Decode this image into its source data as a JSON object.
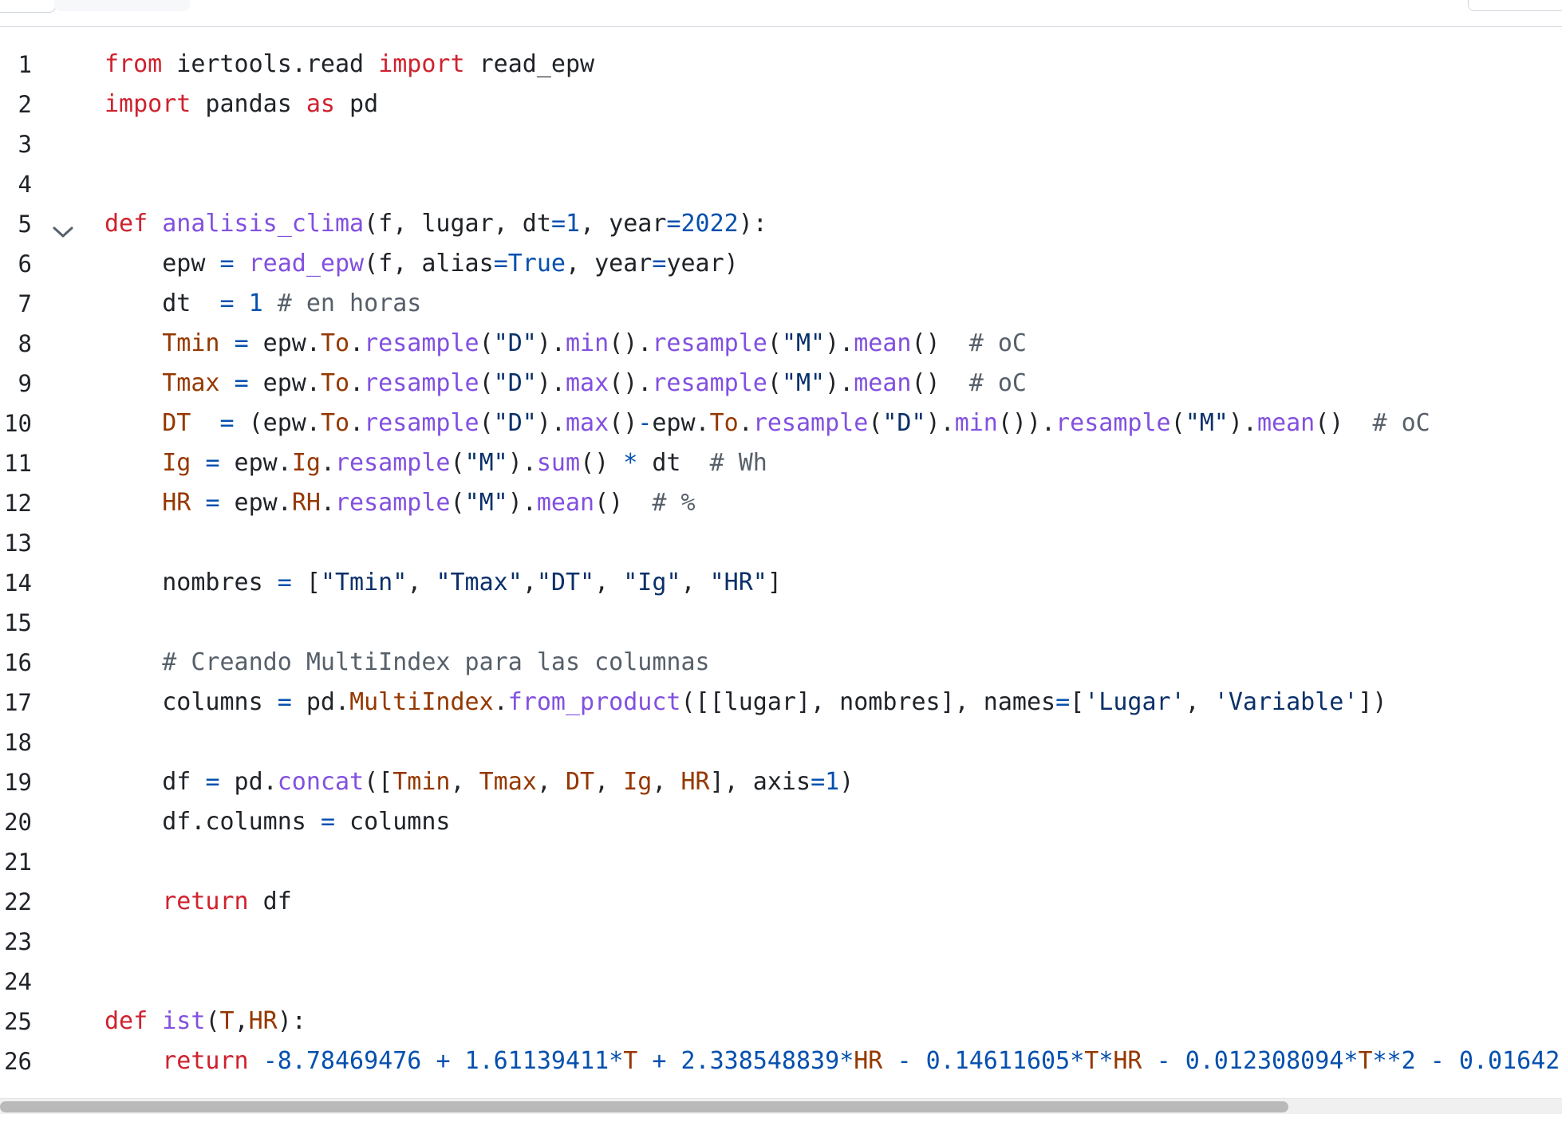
{
  "editor": {
    "lines": [
      {
        "n": "1",
        "html": "<span class=\"kw\">from</span> iertools.read <span class=\"kw\">import</span> read_epw"
      },
      {
        "n": "2",
        "html": "<span class=\"kw\">import</span> pandas <span class=\"kw\">as</span> pd"
      },
      {
        "n": "3",
        "html": ""
      },
      {
        "n": "4",
        "html": ""
      },
      {
        "n": "5",
        "html": "<span class=\"kw\">def</span> <span class=\"fn\">analisis_clima</span>(f, lugar, dt<span class=\"cn\">=</span><span class=\"cn\">1</span>, year<span class=\"cn\">=</span><span class=\"cn\">2022</span>):",
        "fold": true
      },
      {
        "n": "6",
        "html": "    epw <span class=\"cn\">=</span> <span class=\"fn\">read_epw</span>(f, alias<span class=\"cn\">=</span><span class=\"cn\">True</span>, year<span class=\"cn\">=</span>year)"
      },
      {
        "n": "7",
        "html": "    dt  <span class=\"cn\">=</span> <span class=\"cn\">1</span> <span class=\"cm\"># en horas</span>"
      },
      {
        "n": "8",
        "html": "    <span class=\"vr\">Tmin</span> <span class=\"cn\">=</span> epw.<span class=\"vr\">To</span>.<span class=\"fn\">resample</span>(<span class=\"str\">\"D\"</span>).<span class=\"fn\">min</span>().<span class=\"fn\">resample</span>(<span class=\"str\">\"M\"</span>).<span class=\"fn\">mean</span>()  <span class=\"cm\"># oC</span>"
      },
      {
        "n": "9",
        "html": "    <span class=\"vr\">Tmax</span> <span class=\"cn\">=</span> epw.<span class=\"vr\">To</span>.<span class=\"fn\">resample</span>(<span class=\"str\">\"D\"</span>).<span class=\"fn\">max</span>().<span class=\"fn\">resample</span>(<span class=\"str\">\"M\"</span>).<span class=\"fn\">mean</span>()  <span class=\"cm\"># oC</span>"
      },
      {
        "n": "10",
        "html": "    <span class=\"vr\">DT</span>  <span class=\"cn\">=</span> (epw.<span class=\"vr\">To</span>.<span class=\"fn\">resample</span>(<span class=\"str\">\"D\"</span>).<span class=\"fn\">max</span>()<span class=\"cn\">-</span>epw.<span class=\"vr\">To</span>.<span class=\"fn\">resample</span>(<span class=\"str\">\"D\"</span>).<span class=\"fn\">min</span>()).<span class=\"fn\">resample</span>(<span class=\"str\">\"M\"</span>).<span class=\"fn\">mean</span>()  <span class=\"cm\"># oC</span>"
      },
      {
        "n": "11",
        "html": "    <span class=\"vr\">Ig</span> <span class=\"cn\">=</span> epw.<span class=\"vr\">Ig</span>.<span class=\"fn\">resample</span>(<span class=\"str\">\"M\"</span>).<span class=\"fn\">sum</span>() <span class=\"cn\">*</span> dt  <span class=\"cm\"># Wh</span>"
      },
      {
        "n": "12",
        "html": "    <span class=\"vr\">HR</span> <span class=\"cn\">=</span> epw.<span class=\"vr\">RH</span>.<span class=\"fn\">resample</span>(<span class=\"str\">\"M\"</span>).<span class=\"fn\">mean</span>()  <span class=\"cm\"># %</span>"
      },
      {
        "n": "13",
        "html": ""
      },
      {
        "n": "14",
        "html": "    nombres <span class=\"cn\">=</span> [<span class=\"str\">\"Tmin\"</span>, <span class=\"str\">\"Tmax\"</span>,<span class=\"str\">\"DT\"</span>, <span class=\"str\">\"Ig\"</span>, <span class=\"str\">\"HR\"</span>]"
      },
      {
        "n": "15",
        "html": ""
      },
      {
        "n": "16",
        "html": "    <span class=\"cm\"># Creando MultiIndex para las columnas</span>"
      },
      {
        "n": "17",
        "html": "    columns <span class=\"cn\">=</span> pd.<span class=\"vr\">MultiIndex</span>.<span class=\"fn\">from_product</span>([[lugar], nombres], names<span class=\"cn\">=</span>[<span class=\"str\">'Lugar'</span>, <span class=\"str\">'Variable'</span>])"
      },
      {
        "n": "18",
        "html": ""
      },
      {
        "n": "19",
        "html": "    df <span class=\"cn\">=</span> pd.<span class=\"fn\">concat</span>([<span class=\"vr\">Tmin</span>, <span class=\"vr\">Tmax</span>, <span class=\"vr\">DT</span>, <span class=\"vr\">Ig</span>, <span class=\"vr\">HR</span>], axis<span class=\"cn\">=</span><span class=\"cn\">1</span>)"
      },
      {
        "n": "20",
        "html": "    df.columns <span class=\"cn\">=</span> columns"
      },
      {
        "n": "21",
        "html": ""
      },
      {
        "n": "22",
        "html": "    <span class=\"kw\">return</span> df"
      },
      {
        "n": "23",
        "html": ""
      },
      {
        "n": "24",
        "html": ""
      },
      {
        "n": "25",
        "html": "<span class=\"kw\">def</span> <span class=\"fn\">ist</span>(<span class=\"vr\">T</span>,<span class=\"vr\">HR</span>):"
      },
      {
        "n": "26",
        "html": "    <span class=\"kw\">return</span> <span class=\"cn\">-8.78469476</span> <span class=\"cn\">+</span> <span class=\"cn\">1.61139411</span><span class=\"cn\">*</span><span class=\"vr\">T</span> <span class=\"cn\">+</span> <span class=\"cn\">2.338548839</span><span class=\"cn\">*</span><span class=\"vr\">HR</span> <span class=\"cn\">-</span> <span class=\"cn\">0.14611605</span><span class=\"cn\">*</span><span class=\"vr\">T</span><span class=\"cn\">*</span><span class=\"vr\">HR</span> <span class=\"cn\">-</span> <span class=\"cn\">0.012308094</span><span class=\"cn\">*</span><span class=\"vr\">T</span><span class=\"cn\">**</span><span class=\"cn\">2</span> <span class=\"cn\">-</span> <span class=\"cn\">0.01642</span>"
      }
    ]
  },
  "icons": {
    "fold": "chevron-down-icon"
  },
  "colors": {
    "keyword": "#cf222e",
    "function": "#8250df",
    "constant": "#0550ae",
    "string": "#0a3069",
    "variable": "#953800",
    "comment": "#57606a",
    "text": "#1f2328",
    "scrollbar_thumb": "#b9b9b9"
  }
}
